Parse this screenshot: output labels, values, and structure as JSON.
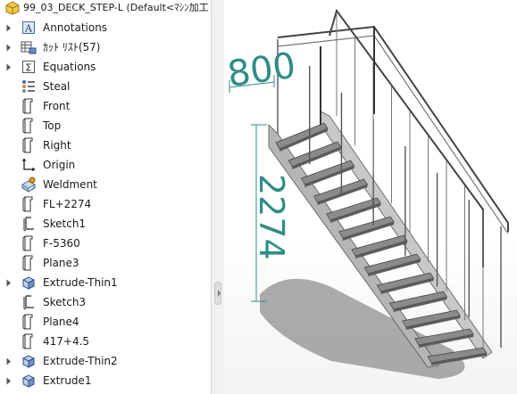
{
  "tree": {
    "root_title": "99_03_DECK_STEP-L  (Default<ﾏｼﾝ加工",
    "items": [
      {
        "label": "Annotations",
        "icon": "annotations-icon",
        "expandable": true
      },
      {
        "label": "ｶｯﾄ ﾘｽﾄ(57)",
        "icon": "cut-list-icon",
        "expandable": true
      },
      {
        "label": "Equations",
        "icon": "equations-icon",
        "expandable": true
      },
      {
        "label": "Steal",
        "icon": "material-icon",
        "expandable": false
      },
      {
        "label": "Front",
        "icon": "plane-icon",
        "expandable": false
      },
      {
        "label": "Top",
        "icon": "plane-icon",
        "expandable": false
      },
      {
        "label": "Right",
        "icon": "plane-icon",
        "expandable": false
      },
      {
        "label": "Origin",
        "icon": "origin-icon",
        "expandable": false
      },
      {
        "label": "Weldment",
        "icon": "weldment-icon",
        "expandable": false
      },
      {
        "label": "FL+2274",
        "icon": "plane-icon",
        "expandable": false
      },
      {
        "label": "Sketch1",
        "icon": "sketch-icon",
        "expandable": false
      },
      {
        "label": "F-5360",
        "icon": "plane-icon",
        "expandable": false
      },
      {
        "label": "Plane3",
        "icon": "plane-icon",
        "expandable": false
      },
      {
        "label": "Extrude-Thin1",
        "icon": "extrude-icon",
        "expandable": true
      },
      {
        "label": "Sketch3",
        "icon": "sketch-icon",
        "expandable": false
      },
      {
        "label": "Plane4",
        "icon": "plane-icon",
        "expandable": false
      },
      {
        "label": "417+4.5",
        "icon": "plane-icon",
        "expandable": false
      },
      {
        "label": "Extrude-Thin2",
        "icon": "extrude-icon",
        "expandable": true
      },
      {
        "label": "Extrude1",
        "icon": "extrude-icon",
        "expandable": true
      }
    ]
  },
  "viewport": {
    "dimension_width": "800",
    "dimension_height": "2274",
    "dimension_color": "#2f8d87"
  }
}
